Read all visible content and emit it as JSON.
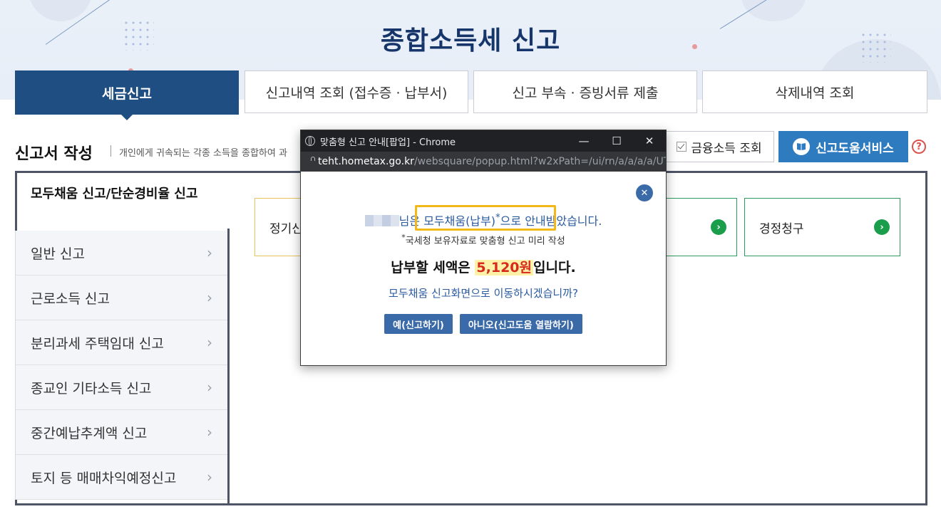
{
  "header": {
    "title": "종합소득세 신고"
  },
  "tabs": [
    {
      "label": "세금신고",
      "active": true
    },
    {
      "label": "신고내역 조회 (접수증 · 납부서)"
    },
    {
      "label": "신고 부속 · 증빙서류 제출"
    },
    {
      "label": "삭제내역 조회"
    }
  ],
  "section": {
    "title": "신고서 작성",
    "description": "개인에게 귀속되는 각종 소득을 종합하여 과",
    "finance_button": "금융소득 조회",
    "help_button": "신고도움서비스",
    "help_icon": "?"
  },
  "sidebar": {
    "active_item": "모두채움 신고/단순경비율 신고",
    "items": [
      {
        "label": "일반 신고"
      },
      {
        "label": "근로소득 신고"
      },
      {
        "label": "분리과세 주택임대 신고"
      },
      {
        "label": "종교인 기타소득 신고"
      },
      {
        "label": "중간예납추계액 신고"
      },
      {
        "label": "토지 등 매매차익예정신고"
      }
    ]
  },
  "cards": {
    "regular": "정기신",
    "correction": "경정청구"
  },
  "popup": {
    "window_title": "맞춤형 신고 안내[팝업] - Chrome",
    "url_host": "teht.hometax.go.kr",
    "url_path": "/websquare/popup.html?w2xPath=/ui/rn/a/a/a/a/UT...",
    "message_suffix1": "님은 ",
    "highlight_text": "모두채움(납부)",
    "asterisk": "*",
    "message_suffix2": "으로 안내받았습니다.",
    "note": "국세청 보유자료로 맞춤형 신고 미리 작성",
    "amount_prefix": "납부할 세액은 ",
    "amount": "5,120원",
    "amount_suffix": "입니다.",
    "question": "모두채움 신고화면으로 이동하시겠습니까?",
    "yes_button": "예(신고하기)",
    "no_button": "아니오(신고도움 열람하기)"
  },
  "colors": {
    "brand_navy": "#1f4e82",
    "help_blue": "#2f7bc0",
    "highlight_yellow": "#f2b817",
    "amount_red": "#d62a1f",
    "go_green": "#1b9e4b"
  },
  "icons": [
    "globe-icon",
    "lock-icon",
    "minimize-icon",
    "maximize-icon",
    "close-icon",
    "book-icon",
    "checkbox-icon",
    "chevron-right-icon",
    "arrow-circle-right-icon",
    "question-icon"
  ]
}
